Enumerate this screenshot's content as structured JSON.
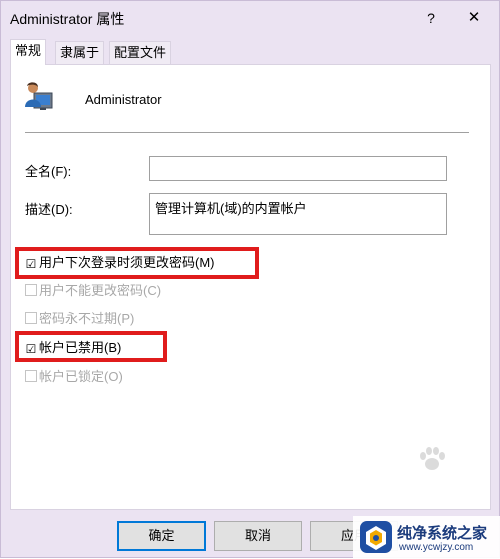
{
  "window": {
    "title": "Administrator 属性",
    "help_glyph": "?",
    "close_glyph": "✕"
  },
  "tabs": [
    {
      "label": "常规",
      "active": true
    },
    {
      "label": "隶属于",
      "active": false
    },
    {
      "label": "配置文件",
      "active": false
    }
  ],
  "general": {
    "user_name": "Administrator",
    "user_icon": "user-account-icon",
    "full_name": {
      "label": "全名(F):",
      "value": ""
    },
    "description": {
      "label": "描述(D):",
      "value": "管理计算机(域)的内置帐户"
    },
    "checkboxes": [
      {
        "label": "用户下次登录时须更改密码(M)",
        "checked": true,
        "enabled": true,
        "highlighted": true
      },
      {
        "label": "用户不能更改密码(C)",
        "checked": false,
        "enabled": false,
        "highlighted": false
      },
      {
        "label": "密码永不过期(P)",
        "checked": false,
        "enabled": false,
        "highlighted": false
      },
      {
        "label": "帐户已禁用(B)",
        "checked": true,
        "enabled": true,
        "highlighted": true
      },
      {
        "label": "帐户已锁定(O)",
        "checked": false,
        "enabled": false,
        "highlighted": false
      }
    ],
    "checked_glyph": "☑"
  },
  "footer": {
    "ok_label": "确定",
    "cancel_label": "取消",
    "apply_label": "应用"
  },
  "watermark": {
    "name": "纯净系统之家",
    "url": "www.ycwjzy.com"
  },
  "colors": {
    "highlight": "#e01c1c",
    "window_bg": "#ebe3f2",
    "focus_border": "#0078d7"
  }
}
